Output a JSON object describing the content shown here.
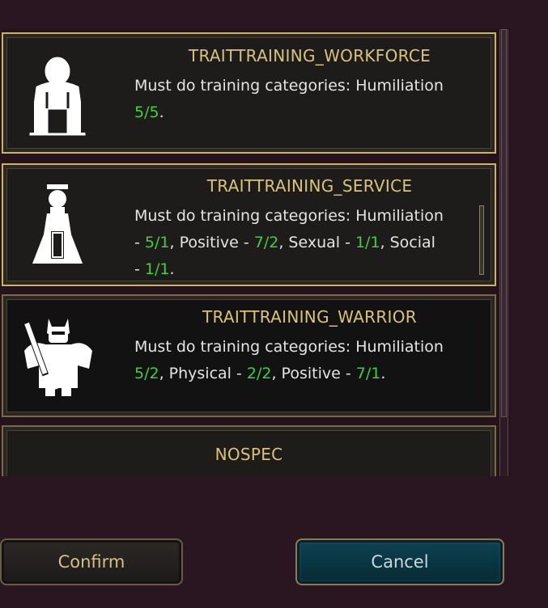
{
  "cards": [
    {
      "title": "TRAITTRAINING_WORKFORCE",
      "line1": "Must do training categories: Humiliation",
      "line2_num": "5/5",
      "line2_end": "."
    },
    {
      "title": "TRAITTRAINING_SERVICE",
      "line1": "Must do training categories: Humiliation",
      "line2_pre": "- ",
      "line2_num1": "5/1",
      "line2_mid1": ", Positive - ",
      "line2_num2": "7/2",
      "line2_mid2": ", Sexual - ",
      "line2_num3": "1/1",
      "line2_mid3": ", Social",
      "line3_pre": "- ",
      "line3_num": "1/1",
      "line3_end": "."
    },
    {
      "title": "TRAITTRAINING_WARRIOR",
      "line1": "Must do training categories: Humiliation",
      "line2_num1": "5/2",
      "line2_mid1": ", Physical - ",
      "line2_num2": "2/2",
      "line2_mid2": ", Positive - ",
      "line2_num3": "7/1",
      "line2_end": "."
    },
    {
      "title": "NOSPEC"
    }
  ],
  "buttons": {
    "confirm": "Confirm",
    "cancel": "Cancel"
  },
  "icons": {
    "workforce": "worker-icon",
    "service": "maid-icon",
    "warrior": "knight-icon"
  },
  "colors": {
    "title": "#d9c27a",
    "value": "#3fcf3f",
    "text": "#e4e4e4"
  }
}
